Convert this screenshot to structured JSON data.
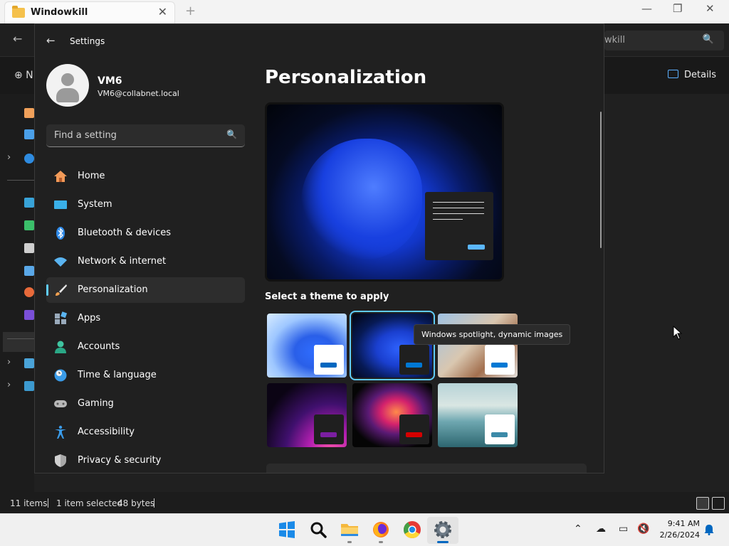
{
  "explorer": {
    "tab_title": "Windowkill",
    "tab_close": "✕",
    "new_tab": "+",
    "window_controls": [
      "—",
      "❐",
      "✕"
    ],
    "back_arrow": "←",
    "search_text": "wkill",
    "new_label": "⊕ N",
    "details_label": "Details",
    "status": {
      "items": "11 items",
      "selected": "1 item selected",
      "size": "48 bytes"
    }
  },
  "settings": {
    "window_title": "Settings",
    "back_arrow": "←",
    "user": {
      "name": "VM6",
      "email": "VM6@collabnet.local"
    },
    "search_placeholder": "Find a setting",
    "nav_items": [
      {
        "label": "Home",
        "icon": "home-icon"
      },
      {
        "label": "System",
        "icon": "system-icon"
      },
      {
        "label": "Bluetooth & devices",
        "icon": "bluetooth-icon"
      },
      {
        "label": "Network & internet",
        "icon": "wifi-icon"
      },
      {
        "label": "Personalization",
        "icon": "brush-icon",
        "selected": true
      },
      {
        "label": "Apps",
        "icon": "apps-icon"
      },
      {
        "label": "Accounts",
        "icon": "person-icon"
      },
      {
        "label": "Time & language",
        "icon": "globe-clock-icon"
      },
      {
        "label": "Gaming",
        "icon": "gamepad-icon"
      },
      {
        "label": "Accessibility",
        "icon": "accessibility-icon"
      },
      {
        "label": "Privacy & security",
        "icon": "shield-icon"
      }
    ],
    "page_title": "Personalization",
    "theme_heading": "Select a theme to apply",
    "selected_theme_index": 1,
    "tooltip": "Windows spotlight, dynamic images"
  },
  "taskbar": {
    "apps": [
      "start-icon",
      "search-icon",
      "file-explorer-icon",
      "firefox-icon",
      "chrome-icon",
      "settings-icon"
    ],
    "time": "9:41 AM",
    "date": "2/26/2024"
  },
  "colors": {
    "accent": "#60cdff",
    "theme_bars": [
      "#0067c0",
      "#0078d4",
      "#0078d4",
      "#7b1fa2",
      "#d50000",
      "#3c8aa8"
    ],
    "theme_mini_bg": [
      "#ffffff",
      "#1f1f1f",
      "#ffffff",
      "#1f1f1f",
      "#1f1f1f",
      "#ffffff"
    ]
  }
}
